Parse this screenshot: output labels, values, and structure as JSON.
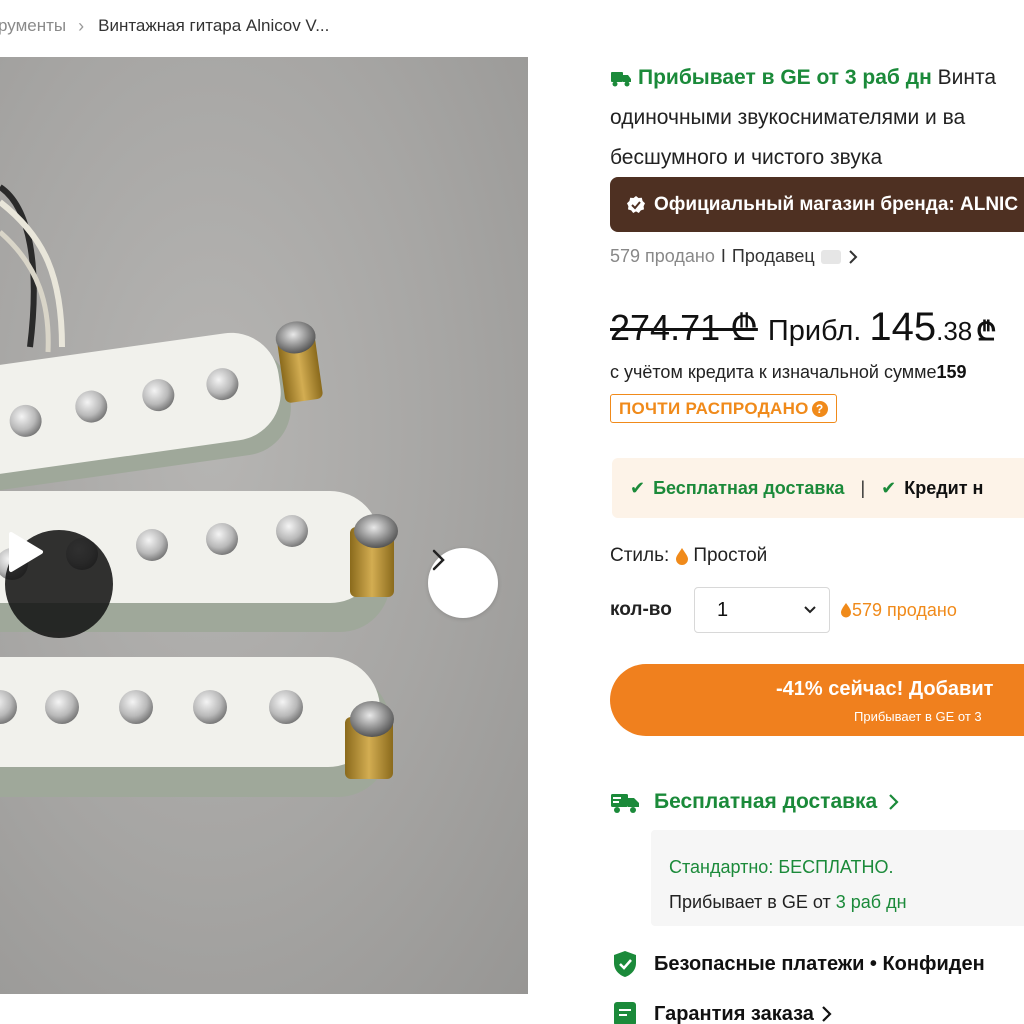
{
  "breadcrumb": {
    "prev": "рументы",
    "separator": "›",
    "current": "Винтажная гитара Alnicov V..."
  },
  "gallery": {
    "play_icon": "play-icon",
    "next_icon": "chevron-right-icon"
  },
  "product": {
    "arrival_badge": "Прибывает в GE от 3 раб дн",
    "title_line1_rest": "Винта",
    "title_line2": "одиночными звукоснимателями и ва",
    "title_line3": "бесшумного и чистого звука"
  },
  "brand_bar": {
    "text": "Официальный магазин бренда: ALNIC",
    "color": "#4e3022"
  },
  "sales": {
    "sold": "579 продано",
    "separator": "I",
    "seller_label": "Продавец"
  },
  "price": {
    "old": "274.71 ₾",
    "approx_label": "Прибл.",
    "integer": "145",
    "decimal": ".38",
    "currency": "₾",
    "credit_note": "с учётом кредита к изначальной сумме",
    "credit_amount": "159"
  },
  "almost_sold_out": "ПОЧТИ РАСПРОДАНО",
  "perks": {
    "free_shipping": "Бесплатная доставка",
    "divider": "|",
    "credit": "Кредит н"
  },
  "style": {
    "label": "Стиль:",
    "value": "Простой"
  },
  "quantity": {
    "label": "кол-во",
    "value": "1",
    "sold_note": "579 продано"
  },
  "cta": {
    "main": "-41% сейчас! Добавит",
    "sub": "Прибывает в GE от 3",
    "color": "#f0801e"
  },
  "shipping": {
    "title": "Бесплатная доставка",
    "standard": "Стандартно: БЕСПЛАТНО.",
    "arrive_prefix": "Прибывает в GE от",
    "arrive_days": "3 раб дн"
  },
  "trust": {
    "secure": "Безопасные платежи • Конфиден",
    "guarantee": "Гарантия заказа"
  },
  "colors": {
    "green": "#1b8a3a",
    "orange": "#f08a1a"
  }
}
